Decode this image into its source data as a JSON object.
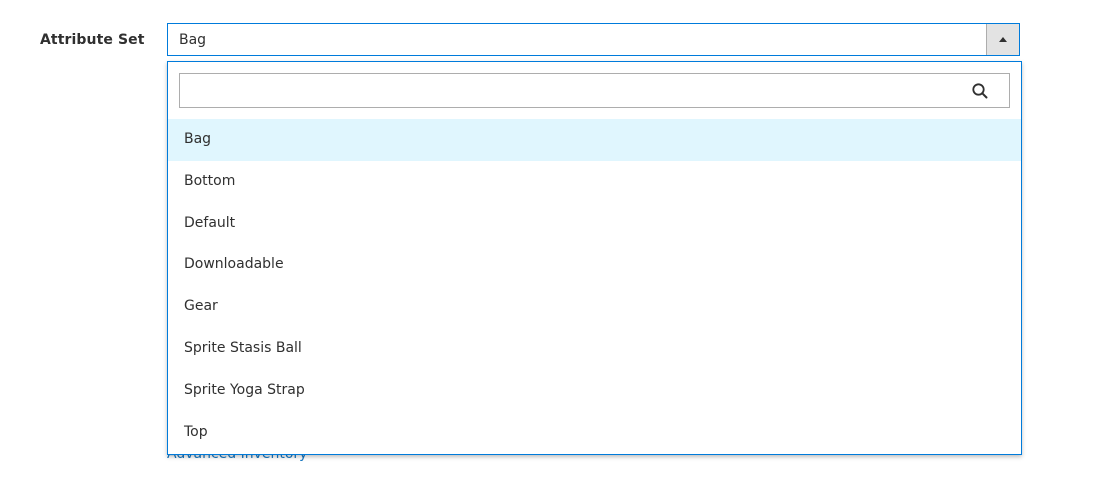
{
  "form": {
    "attribute_set_label": "Attribute Set",
    "selected_value": "Bag"
  },
  "dropdown": {
    "search_placeholder": "",
    "search_icon": "search-icon",
    "options": [
      {
        "label": "Bag",
        "selected": true
      },
      {
        "label": "Bottom",
        "selected": false
      },
      {
        "label": "Default",
        "selected": false
      },
      {
        "label": "Downloadable",
        "selected": false
      },
      {
        "label": "Gear",
        "selected": false
      },
      {
        "label": "Sprite Stasis Ball",
        "selected": false
      },
      {
        "label": "Sprite Yoga Strap",
        "selected": false
      },
      {
        "label": "Top",
        "selected": false
      }
    ]
  },
  "background": {
    "link_text": "Advanced Inventory"
  },
  "colors": {
    "accent_border": "#007bdb",
    "selected_bg": "#e0f6fe",
    "link": "#1979c3"
  }
}
